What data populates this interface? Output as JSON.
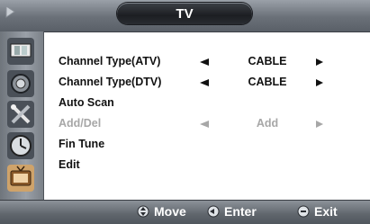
{
  "header": {
    "title": "TV"
  },
  "sidebar": {
    "icons": [
      "picture-icon",
      "sound-icon",
      "setup-tools-icon",
      "time-clock-icon",
      "tv-channel-icon"
    ]
  },
  "menu": {
    "items": [
      {
        "label": "Channel Type(ATV)",
        "value": "CABLE",
        "enabled": true
      },
      {
        "label": "Channel Type(DTV)",
        "value": "CABLE",
        "enabled": true
      },
      {
        "label": "Auto Scan",
        "enabled": true
      },
      {
        "label": "Add/Del",
        "value": "Add",
        "enabled": false
      },
      {
        "label": "Fin Tune",
        "enabled": true
      },
      {
        "label": "Edit",
        "enabled": true
      }
    ]
  },
  "footer": {
    "move_label": "Move",
    "enter_label": "Enter",
    "exit_label": "Exit"
  },
  "colors": {
    "active_text": "#111111",
    "disabled_text": "#a7a7a7",
    "bar_gray": "#6a7078"
  }
}
